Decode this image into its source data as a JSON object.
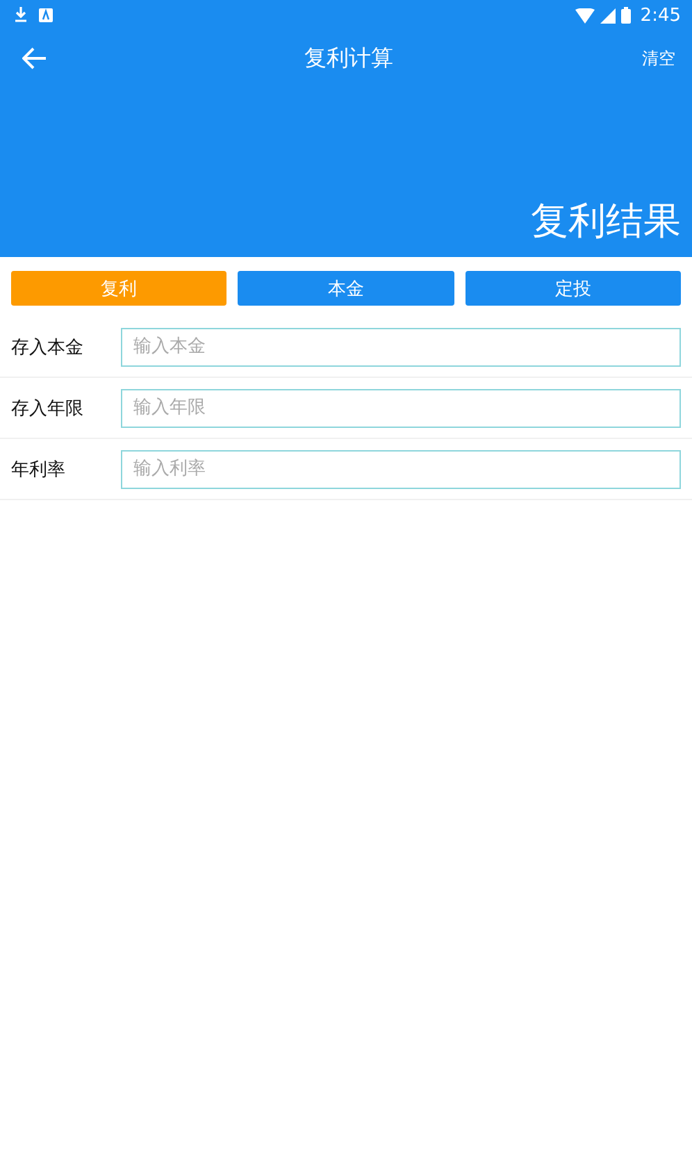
{
  "status_bar": {
    "time": "2:45"
  },
  "app_bar": {
    "title": "复利计算",
    "action": "清空",
    "result_title": "复利结果"
  },
  "tabs": [
    {
      "label": "复利",
      "selected": true
    },
    {
      "label": "本金",
      "selected": false
    },
    {
      "label": "定投",
      "selected": false
    }
  ],
  "fields": [
    {
      "label": "存入本金",
      "placeholder": "输入本金"
    },
    {
      "label": "存入年限",
      "placeholder": "输入年限"
    },
    {
      "label": "年利率",
      "placeholder": "输入利率"
    }
  ]
}
